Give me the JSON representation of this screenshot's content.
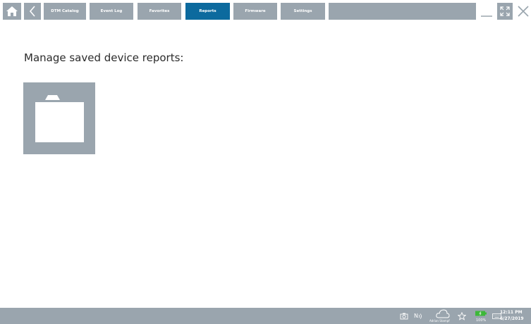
{
  "toolbar": {
    "tabs": [
      {
        "label": "DTM Catalog",
        "active": false
      },
      {
        "label": "Event Log",
        "active": false
      },
      {
        "label": "Favorites",
        "active": false
      },
      {
        "label": "Reports",
        "active": true
      },
      {
        "label": "Firmware",
        "active": false
      },
      {
        "label": "Settings",
        "active": false
      }
    ],
    "icons": {
      "home": "home-icon",
      "back": "back-icon",
      "minimize": "minimize-icon",
      "fullscreen": "fullscreen-icon",
      "close": "close-icon"
    }
  },
  "main": {
    "heading": "Manage saved device reports:",
    "folder_icon": "folder-icon"
  },
  "taskbar": {
    "nfc_label": "N",
    "account_name": "Adrian Stampf",
    "battery_percent": "100%",
    "time": "12:11 PM",
    "date": "6/27/2019"
  },
  "colors": {
    "bar_gray": "#9aa5ae",
    "active_tab": "#0c6a9e",
    "battery_green": "#3db839"
  }
}
